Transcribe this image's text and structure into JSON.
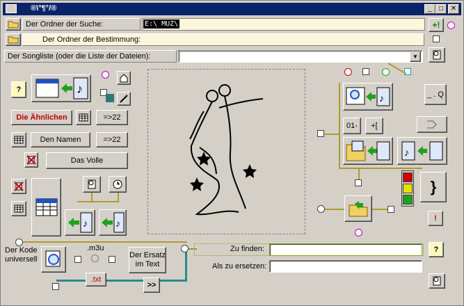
{
  "window": {
    "title": "®\\°¶°/®"
  },
  "search_folder": {
    "label": "Der Ordner der Suche:",
    "value": "E:\\ MUZ\\"
  },
  "dest_folder": {
    "label": "Der Ordner der Bestimmung:"
  },
  "songlist": {
    "label": "Der Songliste (oder die Liste der Dateien):"
  },
  "buttons": {
    "similar": "Die Ähnlichen",
    "names": "Den Namen",
    "full": "Das Volle",
    "arrow22a": "=>22",
    "arrow22b": "=>22",
    "replace_text": "Der Ersatz im Text",
    "txt": ".txt",
    "next": ">>",
    "num01": "01-",
    "plus_bracket": "+[",
    "q": "_ . Q",
    "brace": "}",
    "exclaim": "!",
    "question": "?",
    "question2": "?"
  },
  "labels": {
    "kode": "Der Kode universell",
    "m3u": ".m3u",
    "find": "Zu finden:",
    "replace": "Als zu ersetzen:"
  },
  "inputs": {
    "find_value": "",
    "replace_value": ""
  },
  "colors": {
    "title_bg": "#0a246a",
    "accent_line": "#b09b2b",
    "teal_line": "#2a8a8a"
  }
}
